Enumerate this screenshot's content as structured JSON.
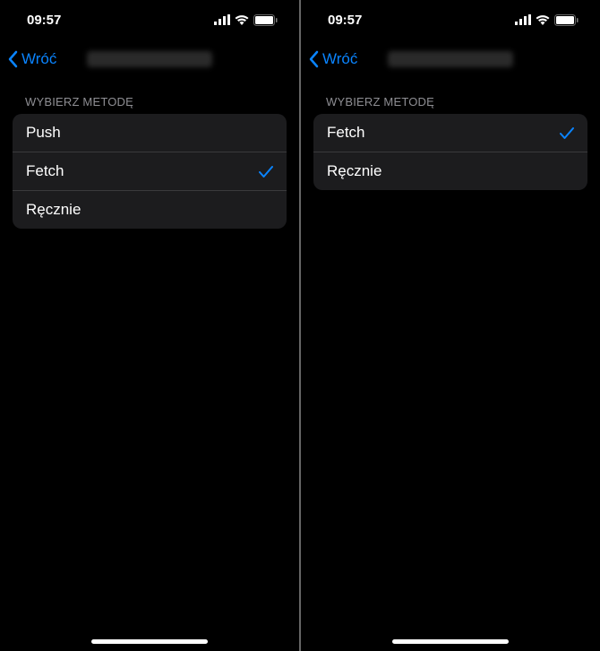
{
  "status": {
    "time": "09:57"
  },
  "nav": {
    "back_label": "Wróć"
  },
  "section": {
    "header": "WYBIERZ METODĘ"
  },
  "left": {
    "options": [
      {
        "label": "Push",
        "selected": false
      },
      {
        "label": "Fetch",
        "selected": true
      },
      {
        "label": "Ręcznie",
        "selected": false
      }
    ]
  },
  "right": {
    "options": [
      {
        "label": "Fetch",
        "selected": true
      },
      {
        "label": "Ręcznie",
        "selected": false
      }
    ]
  },
  "colors": {
    "accent": "#0a84ff"
  }
}
